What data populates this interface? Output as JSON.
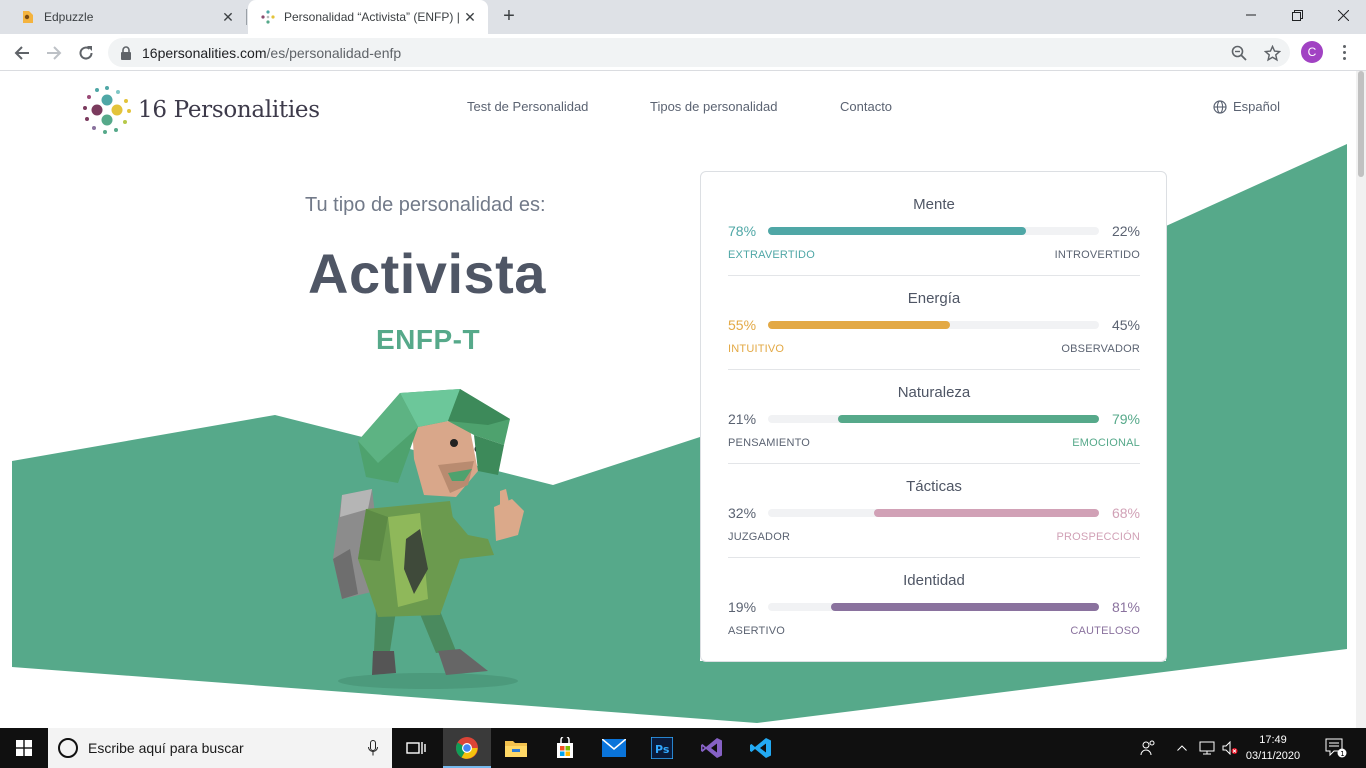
{
  "browser": {
    "tabs": [
      {
        "title": "Edpuzzle",
        "active": false
      },
      {
        "title": "Personalidad “Activista” (ENFP) |",
        "active": true
      }
    ],
    "url_host": "16personalities.com",
    "url_path": "/es/personalidad-enfp",
    "profile_initial": "C"
  },
  "site": {
    "logo_text": "16 Personalities",
    "nav": [
      "Test de Personalidad",
      "Tipos de personalidad",
      "Contacto"
    ],
    "language": "Español"
  },
  "hero": {
    "intro": "Tu tipo de personalidad es:",
    "type_name": "Activista",
    "type_code": "ENFP-T"
  },
  "traits": [
    {
      "name": "Mente",
      "left_pct": "78%",
      "right_pct": "22%",
      "left_label": "EXTRAVERTIDO",
      "right_label": "INTROVERTIDO",
      "value": 78,
      "side": "left",
      "color": "#4fa7a6"
    },
    {
      "name": "Energía",
      "left_pct": "55%",
      "right_pct": "45%",
      "left_label": "INTUITIVO",
      "right_label": "OBSERVADOR",
      "value": 55,
      "side": "left",
      "color": "#e3a945"
    },
    {
      "name": "Naturaleza",
      "left_pct": "21%",
      "right_pct": "79%",
      "left_label": "PENSAMIENTO",
      "right_label": "EMOCIONAL",
      "value": 79,
      "side": "right",
      "color": "#56a98a"
    },
    {
      "name": "Tácticas",
      "left_pct": "32%",
      "right_pct": "68%",
      "left_label": "JUZGADOR",
      "right_label": "PROSPECCIÓN",
      "value": 68,
      "side": "right",
      "color": "#d1a1b6"
    },
    {
      "name": "Identidad",
      "left_pct": "19%",
      "right_pct": "81%",
      "left_label": "ASERTIVO",
      "right_label": "CAUTELOSO",
      "value": 81,
      "side": "right",
      "color": "#8a729e"
    }
  ],
  "taskbar": {
    "search_placeholder": "Escribe aquí para buscar",
    "time": "17:49",
    "date": "03/11/2020",
    "notification_count": "1"
  }
}
